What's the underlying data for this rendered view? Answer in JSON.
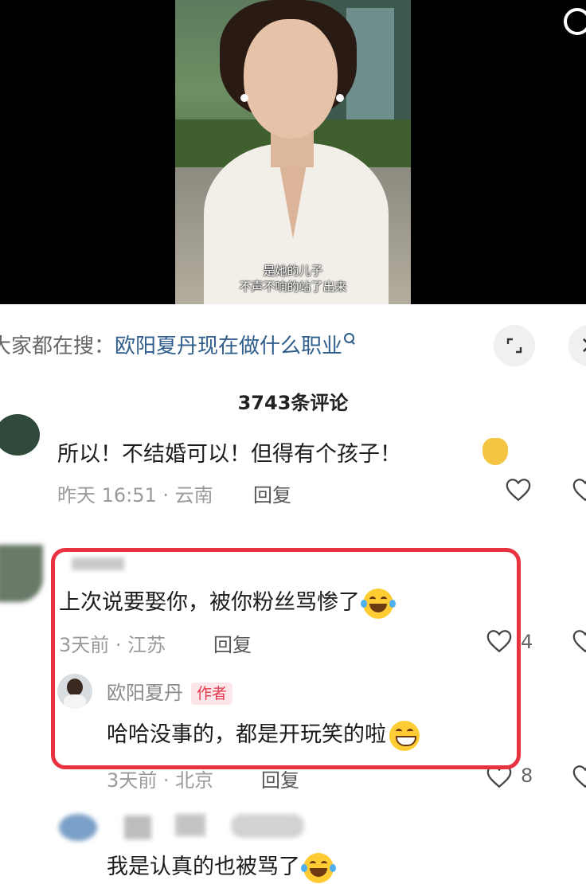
{
  "video": {
    "subtitle_line1": "是她的儿子",
    "subtitle_line2": "不声不响的站了出来"
  },
  "search": {
    "prefix": "大家都在搜：",
    "term": "欧阳夏丹现在做什么职业"
  },
  "comments_header": {
    "count_label": "3743条评论"
  },
  "comments": [
    {
      "text": "所以！不结婚可以！但得有个孩子！",
      "meta": "昨天 16:51 · 云南",
      "reply_label": "回复"
    },
    {
      "text": "上次说要娶你，被你粉丝骂惨了",
      "meta": "3天前 · 江苏",
      "reply_label": "回复",
      "likes": "4",
      "reply": {
        "author": "欧阳夏丹",
        "author_tag": "作者",
        "text": "哈哈没事的，都是开玩笑的啦",
        "meta": "3天前 · 北京",
        "reply_label": "回复",
        "likes": "8"
      }
    },
    {
      "text": "我是认真的也被骂了"
    }
  ],
  "colors": {
    "search_term": "#2f5d8c",
    "highlight_box": "#e8323f",
    "author_tag_bg": "#fde6ea",
    "author_tag_text": "#e23a4e"
  }
}
